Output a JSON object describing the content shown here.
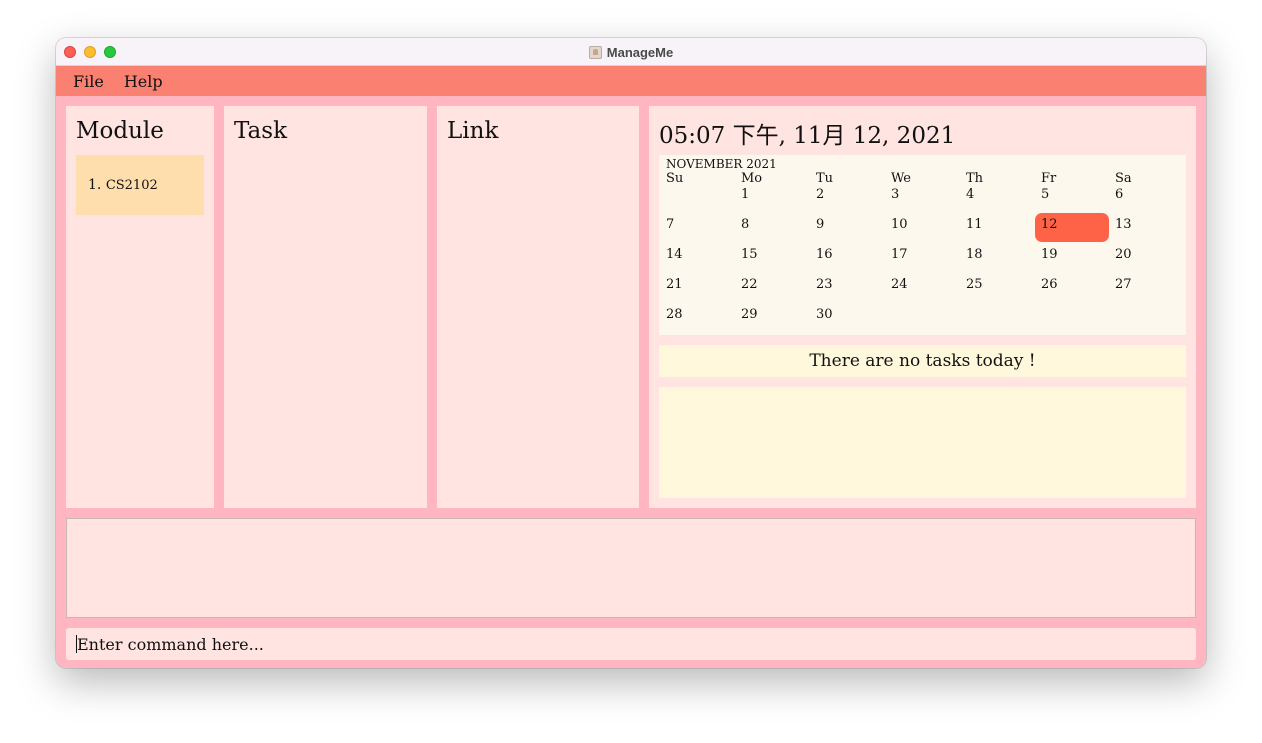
{
  "window": {
    "title": "ManageMe"
  },
  "menu": {
    "items": [
      "File",
      "Help"
    ]
  },
  "panels": {
    "module_title": "Module",
    "task_title": "Task",
    "link_title": "Link"
  },
  "modules": [
    {
      "index": "1.",
      "name": "CS2102"
    }
  ],
  "clock": "05:07 下午, 11月 12, 2021",
  "calendar": {
    "month_label": "NOVEMBER 2021",
    "weekdays": [
      "Su",
      "Mo",
      "Tu",
      "We",
      "Th",
      "Fr",
      "Sa"
    ],
    "weeks": [
      [
        "",
        "1",
        "2",
        "3",
        "4",
        "5",
        "6"
      ],
      [
        "7",
        "8",
        "9",
        "10",
        "11",
        "12",
        "13"
      ],
      [
        "14",
        "15",
        "16",
        "17",
        "18",
        "19",
        "20"
      ],
      [
        "21",
        "22",
        "23",
        "24",
        "25",
        "26",
        "27"
      ],
      [
        "28",
        "29",
        "30",
        "",
        "",
        "",
        ""
      ]
    ],
    "today": "12"
  },
  "tasks_today_message": "There are no tasks today !",
  "command": {
    "placeholder": "Enter command here..."
  },
  "colors": {
    "menubar": "#fa8072",
    "background": "#ffb6c1",
    "panel": "#ffe4e1",
    "module_card": "#ffdead",
    "calendar_bg": "#fdf8ee",
    "today_highlight": "#ff6347",
    "task_box": "#fff8dc"
  }
}
